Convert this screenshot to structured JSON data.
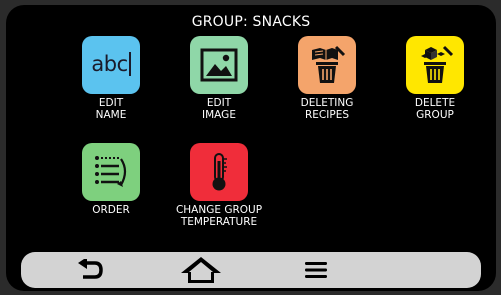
{
  "header": {
    "title": "GROUP: SNACKS"
  },
  "tiles": [
    {
      "label": "EDIT\nNAME",
      "icon": "text-cursor-icon",
      "icon_text": "abc",
      "color": "#5bc3ef"
    },
    {
      "label": "EDIT\nIMAGE",
      "icon": "image-icon",
      "color": "#8fd7a8"
    },
    {
      "label": "DELETING\nRECIPES",
      "icon": "delete-recipes-icon",
      "color": "#f4a46b"
    },
    {
      "label": "DELETE\nGROUP",
      "icon": "delete-group-icon",
      "color": "#ffe700"
    },
    {
      "label": "ORDER",
      "icon": "order-list-icon",
      "color": "#7ed07e"
    },
    {
      "label": "CHANGE GROUP\nTEMPERATURE",
      "icon": "thermometer-icon",
      "color": "#f02d3a"
    }
  ],
  "navbar": {
    "back": "back-arrow-icon",
    "home": "home-icon",
    "menu": "menu-icon"
  }
}
